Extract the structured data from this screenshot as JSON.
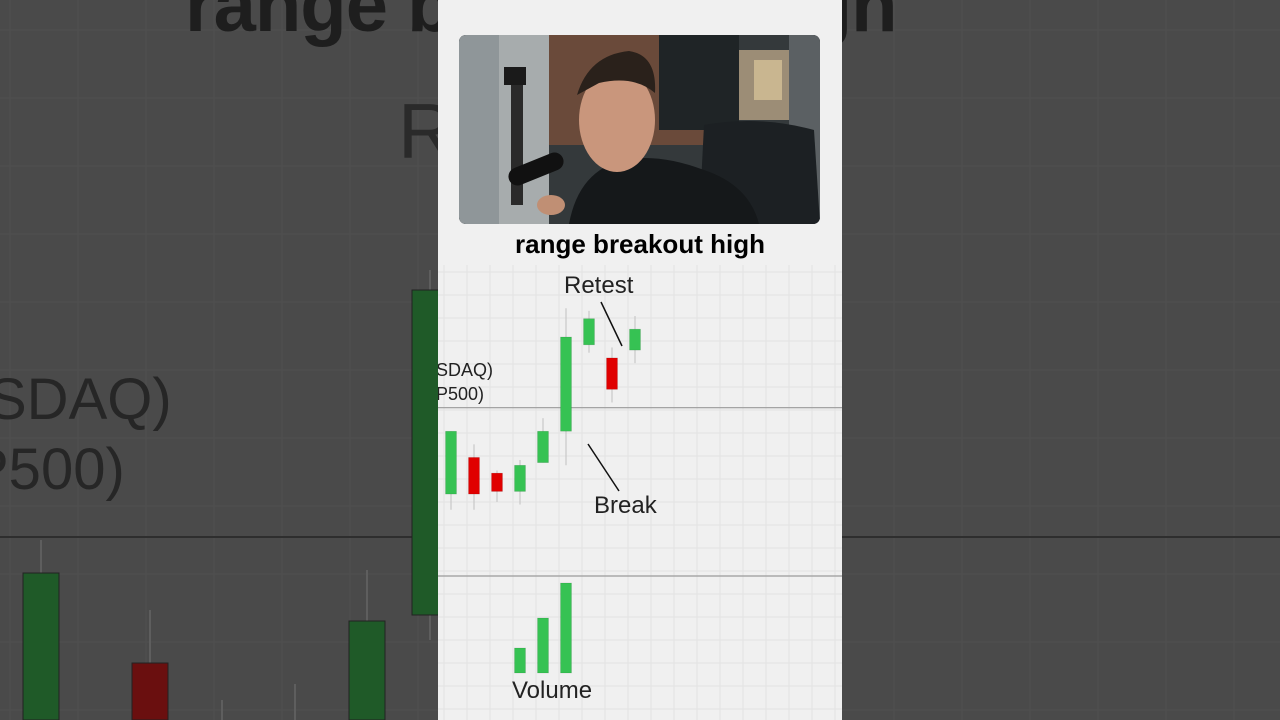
{
  "title": "range breakout high",
  "background": {
    "title_fragment": "range breakout high",
    "sub_fragment": "R",
    "line1": "SDAQ)",
    "line2": "P500)"
  },
  "chart": {
    "index_label_1": "SDAQ)",
    "index_label_2": "P500)",
    "annotations": {
      "retest": "Retest",
      "break": "Break",
      "volume": "Volume"
    }
  },
  "chart_data": {
    "type": "candlestick",
    "candles": [
      {
        "open": 40,
        "close": 64,
        "high": 64,
        "low": 34,
        "dir": "up"
      },
      {
        "open": 54,
        "close": 40,
        "high": 59,
        "low": 34,
        "dir": "down"
      },
      {
        "open": 48,
        "close": 41,
        "high": 49,
        "low": 37,
        "dir": "down"
      },
      {
        "open": 41,
        "close": 51,
        "high": 53,
        "low": 36,
        "dir": "up"
      },
      {
        "open": 52,
        "close": 64,
        "high": 69,
        "low": 52,
        "dir": "up"
      },
      {
        "open": 64,
        "close": 100,
        "high": 111,
        "low": 51,
        "dir": "up"
      },
      {
        "open": 97,
        "close": 107,
        "high": 110,
        "low": 94,
        "dir": "up"
      },
      {
        "open": 92,
        "close": 80,
        "high": 96,
        "low": 75,
        "dir": "down"
      },
      {
        "open": 95,
        "close": 103,
        "high": 108,
        "low": 90,
        "dir": "up"
      }
    ],
    "range_high": 73,
    "volume": [
      {
        "candle": 3,
        "value": 25
      },
      {
        "candle": 4,
        "value": 55
      },
      {
        "candle": 5,
        "value": 90
      }
    ],
    "colors": {
      "up": "#36c253",
      "down": "#e00000",
      "background": "#f0f0f0",
      "grid": "#e2e2e2",
      "line": "#9a9a9a"
    }
  }
}
